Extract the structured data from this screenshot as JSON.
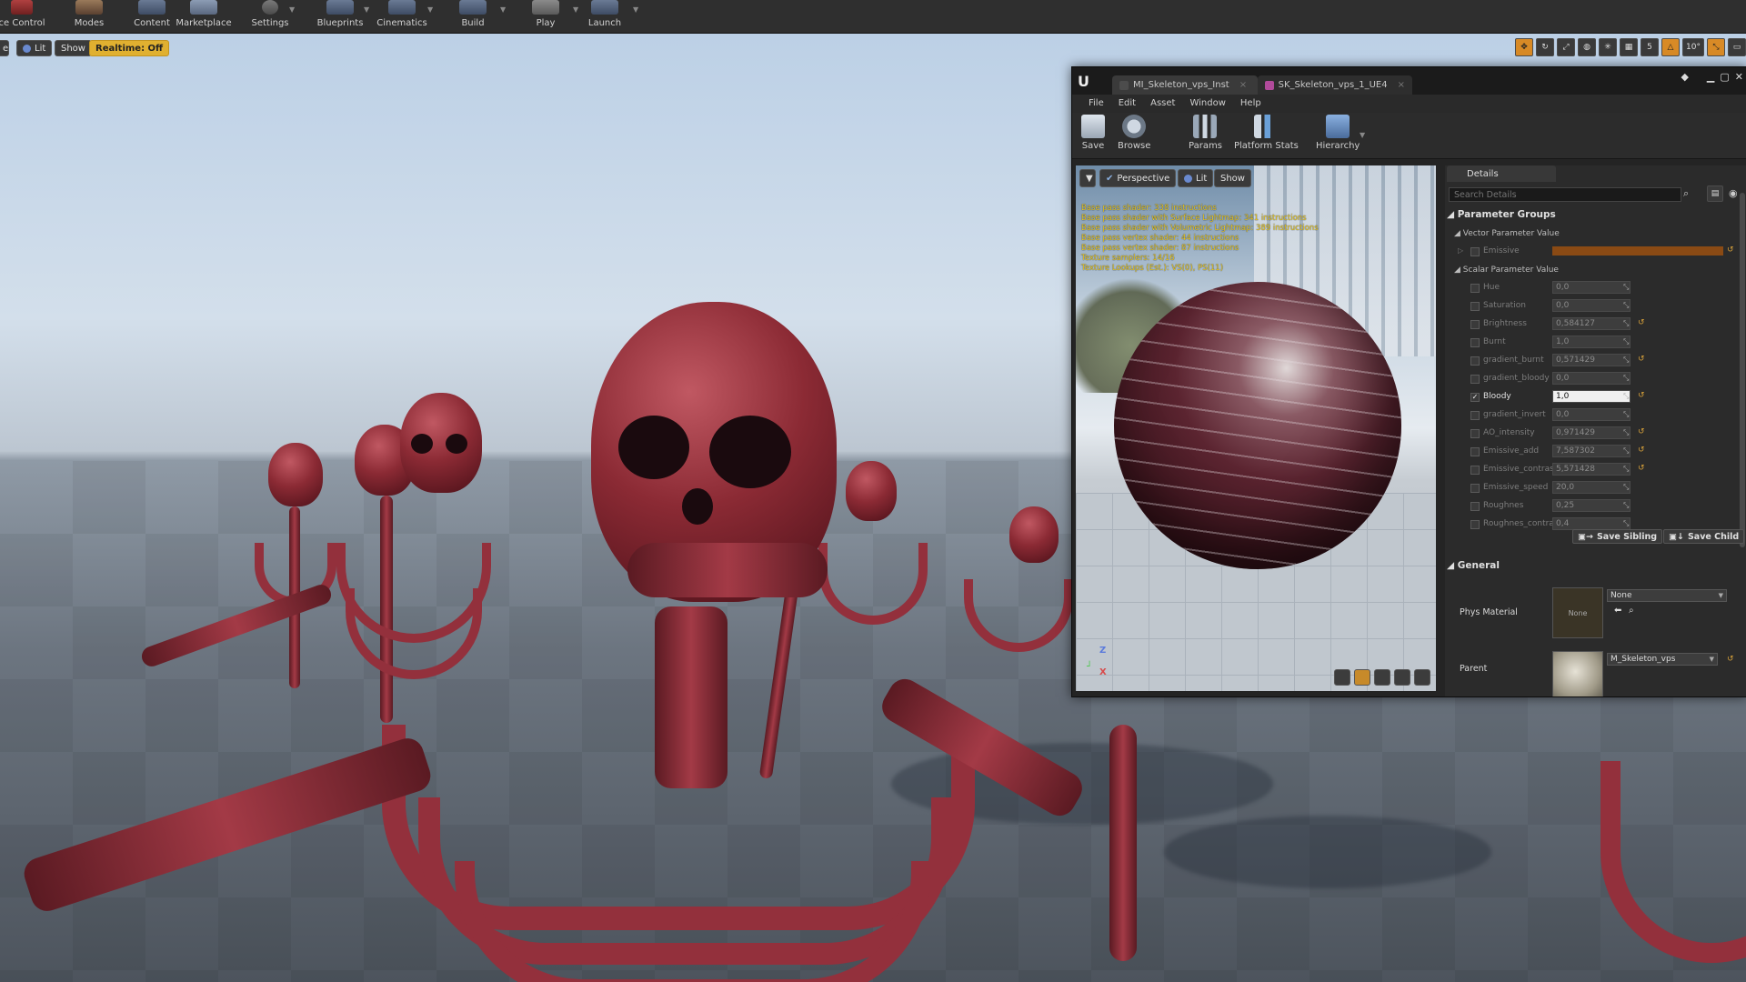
{
  "main_toolbar": {
    "items": [
      {
        "label": "ce Control"
      },
      {
        "label": "Modes"
      },
      {
        "label": "Content"
      },
      {
        "label": "Marketplace"
      },
      {
        "label": "Settings"
      },
      {
        "label": "Blueprints"
      },
      {
        "label": "Cinematics"
      },
      {
        "label": "Build"
      },
      {
        "label": "Play"
      },
      {
        "label": "Launch"
      }
    ]
  },
  "viewport": {
    "lit_label": "Lit",
    "show_label": "Show",
    "realtime_label": "Realtime: Off",
    "grid_snap_value": "5",
    "rotation_snap_value": "10°"
  },
  "material_editor": {
    "tabs": [
      {
        "label": "MI_Skeleton_vps_Inst"
      },
      {
        "label": "SK_Skeleton_vps_1_UE4"
      }
    ],
    "menu": [
      "File",
      "Edit",
      "Asset",
      "Window",
      "Help"
    ],
    "toolbar": {
      "save": "Save",
      "browse": "Browse",
      "params": "Params",
      "platform_stats": "Platform Stats",
      "hierarchy": "Hierarchy"
    },
    "preview": {
      "perspective": "Perspective",
      "lit": "Lit",
      "show": "Show",
      "stats": [
        "Base pass shader: 338 instructions",
        "Base pass shader with Surface Lightmap: 341 instructions",
        "Base pass shader with Volumetric Lightmap: 389 instructions",
        "Base pass vertex shader: 44 instructions",
        "Base pass vertex shader: 87 instructions",
        "Texture samplers: 14/16",
        "Texture Lookups (Est.): VS(0), PS(11)"
      ],
      "axis_z": "Z",
      "axis_x": "X"
    },
    "details": {
      "tab": "Details",
      "search_placeholder": "Search Details",
      "parameter_groups": "Parameter Groups",
      "vector_header": "Vector Parameter Value",
      "emissive_label": "Emissive",
      "emissive_color": "#8a4a14",
      "scalar_header": "Scalar Parameter Value",
      "scalars": [
        {
          "name": "Hue",
          "value": "0,0"
        },
        {
          "name": "Saturation",
          "value": "0,0"
        },
        {
          "name": "Brightness",
          "value": "0,584127"
        },
        {
          "name": "Burnt",
          "value": "1,0"
        },
        {
          "name": "gradient_burnt",
          "value": "0,571429"
        },
        {
          "name": "gradient_bloody",
          "value": "0,0"
        },
        {
          "name": "Bloody",
          "value": "1,0",
          "checked": true
        },
        {
          "name": "gradient_invert",
          "value": "0,0"
        },
        {
          "name": "AO_intensity",
          "value": "0,971429"
        },
        {
          "name": "Emissive_add",
          "value": "7,587302"
        },
        {
          "name": "Emissive_contrast",
          "value": "5,571428"
        },
        {
          "name": "Emissive_speed",
          "value": "20,0"
        },
        {
          "name": "Roughnes",
          "value": "0,25"
        },
        {
          "name": "Roughnes_contras",
          "value": "0,4"
        }
      ],
      "save_sibling": "Save Sibling",
      "save_child": "Save Child",
      "general": "General",
      "phys_material_label": "Phys Material",
      "phys_material_thumb": "None",
      "phys_material_value": "None",
      "parent_label": "Parent",
      "parent_value": "M_Skeleton_vps"
    }
  }
}
